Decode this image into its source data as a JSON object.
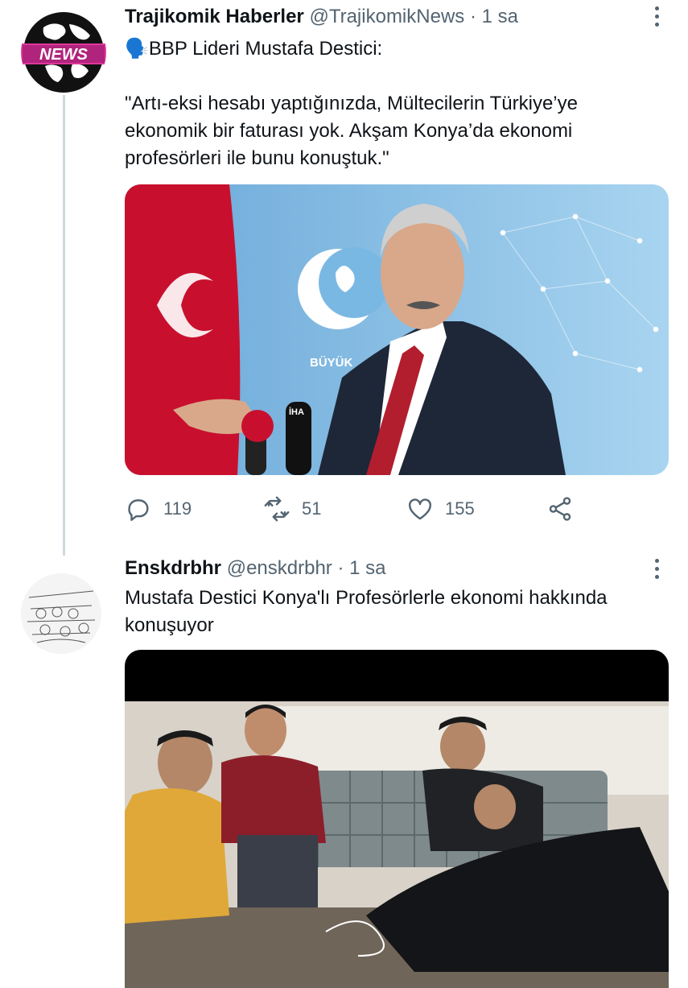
{
  "tweets": [
    {
      "display_name": "Trajikomik Haberler",
      "handle": "@TrajikomikNews",
      "separator": "·",
      "time": "1 sa",
      "avatar_label": "NEWS",
      "text": "🗣️BBP Lideri Mustafa Destici:\n\n\"Artı-eksi hesabı yaptığınızda, Mültecilerin Türkiye’ye ekonomik bir faturası yok. Akşam Konya’da ekonomi profesörleri ile bunu konuştuk.\"",
      "image_texts": {
        "banner": "BÜYÜK",
        "mic_brand": "İHA"
      },
      "stats": {
        "replies": "119",
        "retweets": "51",
        "likes": "155"
      }
    },
    {
      "display_name": "Enskdrbhr",
      "handle": "@enskdrbhr",
      "separator": "·",
      "time": "1 sa",
      "text": "Mustafa Destici Konya'lı Profesörlerle ekonomi hakkında konuşuyor"
    }
  ],
  "colors": {
    "text_primary": "#0f1419",
    "text_secondary": "#536471",
    "thread_line": "#cfd9de",
    "flag_red": "#c8102e",
    "backdrop_blue": "#8fc3e6"
  },
  "icons": [
    "speaking-head-icon",
    "reply-icon",
    "retweet-icon",
    "like-icon",
    "share-icon",
    "more-icon"
  ]
}
